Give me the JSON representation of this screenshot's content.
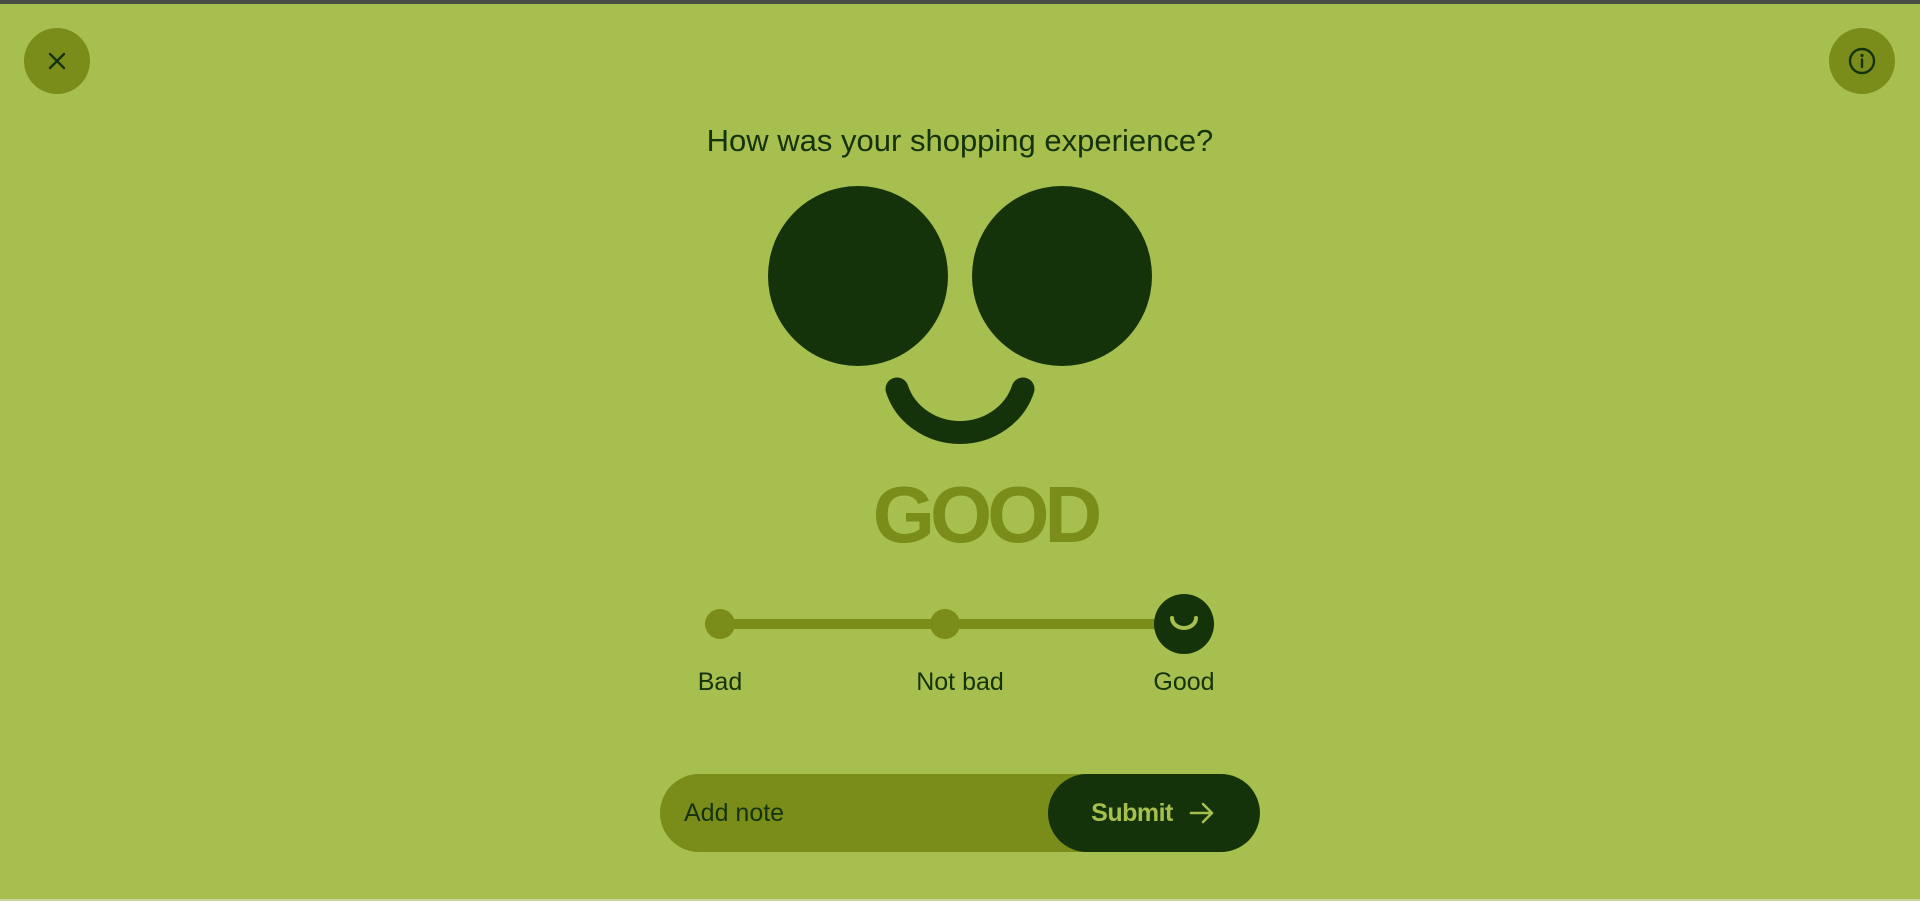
{
  "header": {
    "close_icon": "close-icon",
    "info_icon": "info-icon"
  },
  "question": "How was your shopping experience?",
  "mood": {
    "title": "GOOD",
    "face_icon": "smiling-face-icon"
  },
  "scale": {
    "options": [
      {
        "label": "Bad"
      },
      {
        "label": "Not bad"
      },
      {
        "label": "Good"
      }
    ],
    "selected_index": 2,
    "selected_icon": "smile-icon"
  },
  "note": {
    "placeholder": "Add note",
    "value": ""
  },
  "submit": {
    "label": "Submit",
    "icon": "arrow-right-icon"
  },
  "colors": {
    "background": "#a7bf4e",
    "accent": "#7a8d1b",
    "dark": "#14330a"
  }
}
